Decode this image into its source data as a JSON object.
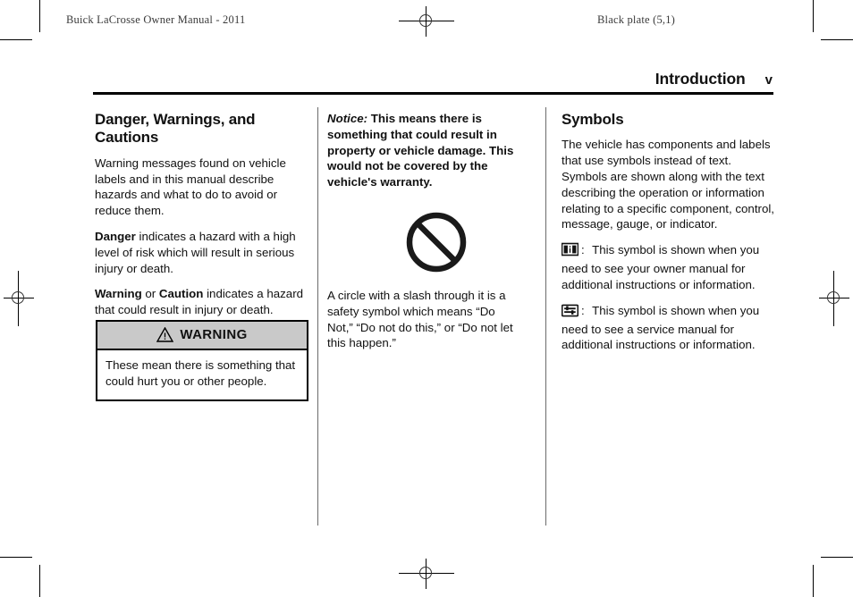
{
  "running_heads": {
    "manual_title": "Buick LaCrosse Owner Manual - 2011",
    "black_plate": "Black plate (5,1)"
  },
  "page_header": {
    "section": "Introduction",
    "folio": "v"
  },
  "columns": {
    "left": {
      "heading": "Danger, Warnings, and Cautions",
      "paragraph_1": "Warning messages found on vehicle labels and in this manual describe hazards and what to do to avoid or reduce them.",
      "paragraph_2_lead": "Danger",
      "paragraph_2_rest": " indicates a hazard with a high level of risk which will result in serious injury or death.",
      "paragraph_3_lead_a": "Warning",
      "paragraph_3_mid": " or ",
      "paragraph_3_lead_b": "Caution",
      "paragraph_3_rest": " indicates a hazard that could result in injury or death."
    },
    "middle": {
      "notice_label": "Notice:",
      "notice_text": " This means there is something that could result in property or vehicle damage. This would not be covered by the vehicle's warranty.",
      "symbol_caption": "A circle with a slash through it is a safety symbol which means “Do Not,” “Do not do this,” or “Do not let this happen.”"
    },
    "right": {
      "heading": "Symbols",
      "paragraph_1": "The vehicle has components and labels that use symbols instead of text. Symbols are shown along with the text describing the operation or information relating to a specific component, control, message, gauge, or indicator.",
      "symbol_items": [
        {
          "icon": "owner-manual-book-icon",
          "separator": ":",
          "text": " This symbol is shown when you need to see your owner manual for additional instructions or information."
        },
        {
          "icon": "service-manual-icon",
          "separator": ":",
          "text": " This symbol is shown when you need to see a service manual for additional instructions or information."
        }
      ]
    }
  },
  "warning_box": {
    "icon": "warning-triangle-icon",
    "title": "WARNING",
    "body": "These mean there is something that could hurt you or other people.",
    "header_fill": "#c9c9c9",
    "border_color": "#000000"
  },
  "prohibition_symbol": {
    "icon": "circle-slash-icon",
    "color": "#1a1a1a"
  },
  "print_marks": {
    "registration_icon": "registration-crosshair-icon",
    "crop_icon": "crop-mark"
  }
}
